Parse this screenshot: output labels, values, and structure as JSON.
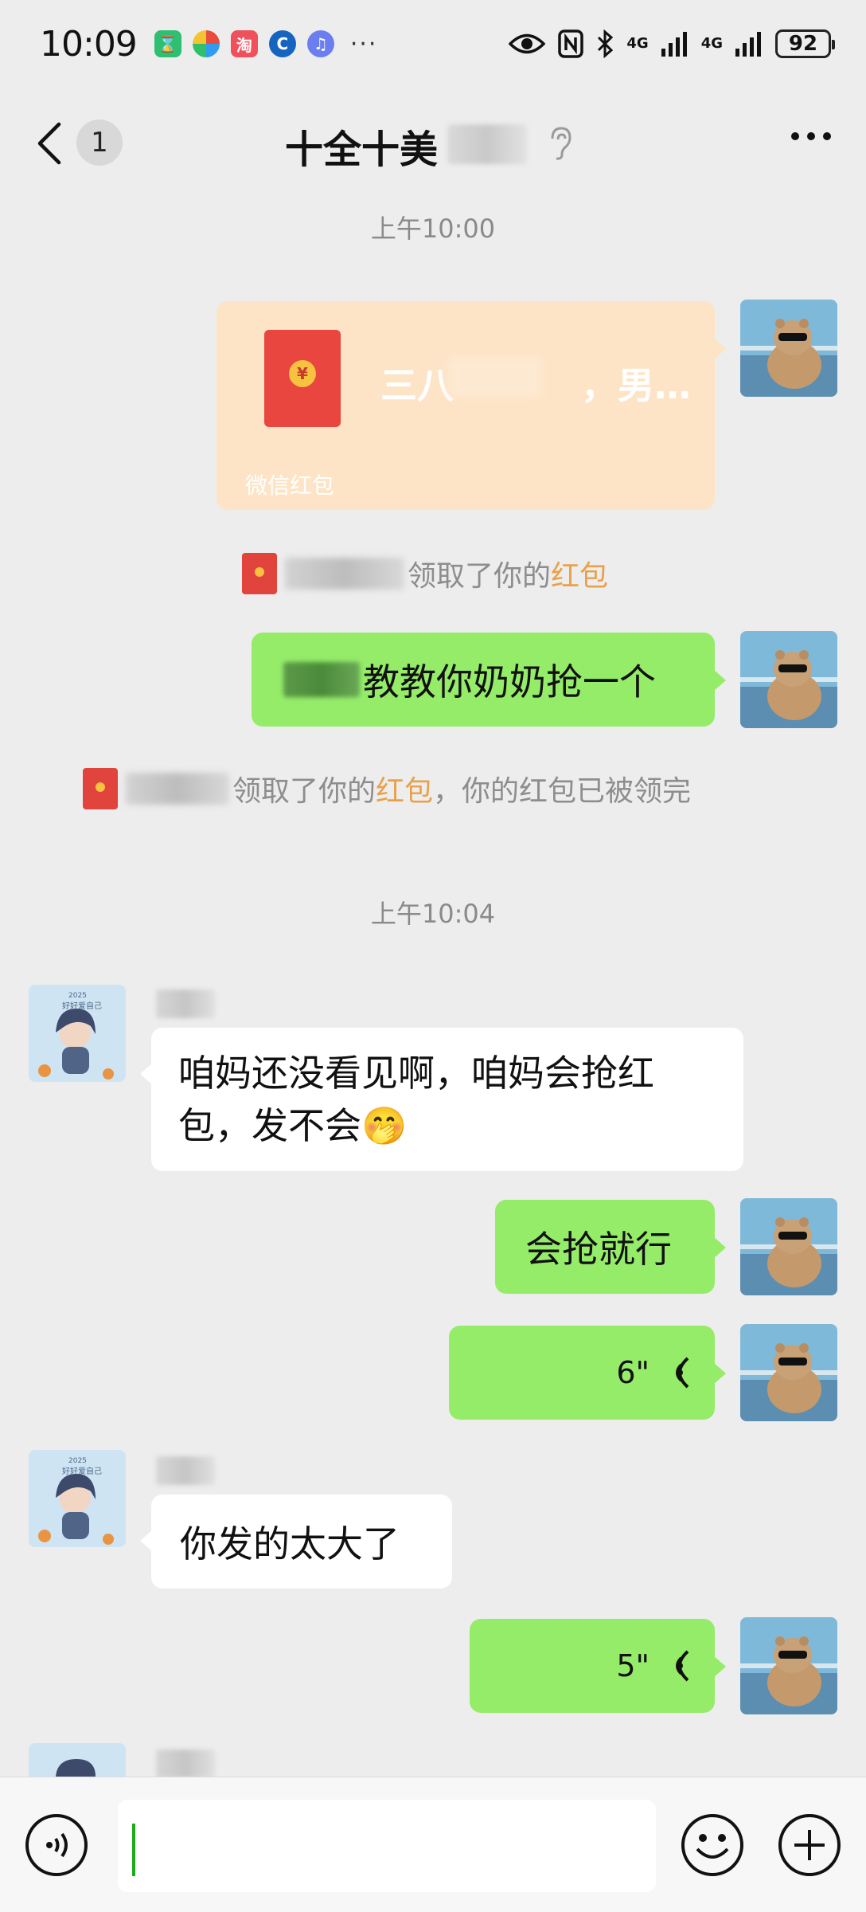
{
  "status_bar": {
    "time": "10:09",
    "more": "···",
    "net1": "4G",
    "net2": "4G",
    "battery": "92"
  },
  "header": {
    "unread_count": "1",
    "title": "十全十美"
  },
  "timestamps": [
    "上午10:00",
    "上午10:04"
  ],
  "red_packet": {
    "title_start": "三八",
    "title_end": "，男…",
    "label": "微信红包"
  },
  "system_messages": [
    {
      "action": "领取了你的",
      "highlight": "红包",
      "suffix": ""
    },
    {
      "action": "领取了你的",
      "highlight": "红包",
      "suffix": "，你的红包已被领完"
    }
  ],
  "messages": [
    {
      "side": "me",
      "text": "教教你奶奶抢一个"
    },
    {
      "side": "them",
      "text": "咱妈还没看见啊，咱妈会抢红包，发不会🤭"
    },
    {
      "side": "me",
      "text": "会抢就行"
    },
    {
      "side": "me",
      "voice_duration": "6\""
    },
    {
      "side": "them",
      "text": "你发的太大了"
    },
    {
      "side": "me",
      "voice_duration": "5\""
    }
  ],
  "avatar_text": {
    "year": "2025",
    "caption": "好好爱自己"
  },
  "colors": {
    "background": "#ededed",
    "my_bubble": "#95ec69",
    "their_bubble": "#ffffff",
    "red_packet_bg": "#fde4c6",
    "red_packet_highlight": "#e8a14a"
  }
}
